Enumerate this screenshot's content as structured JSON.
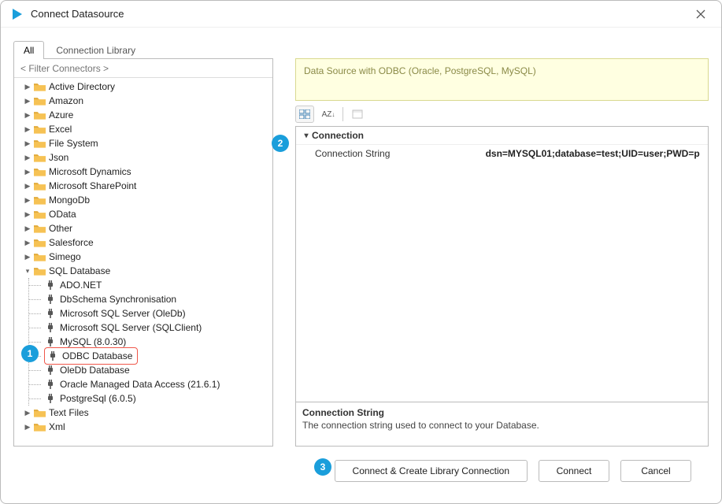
{
  "window": {
    "title": "Connect Datasource"
  },
  "tabs": {
    "all": "All",
    "lib": "Connection Library"
  },
  "filterPlaceholder": "< Filter Connectors >",
  "tree": {
    "activeDirectory": "Active Directory",
    "amazon": "Amazon",
    "azure": "Azure",
    "excel": "Excel",
    "fileSystem": "File System",
    "json": "Json",
    "msDynamics": "Microsoft Dynamics",
    "msSharepoint": "Microsoft SharePoint",
    "mongo": "MongoDb",
    "odata": "OData",
    "other": "Other",
    "salesforce": "Salesforce",
    "simego": "Simego",
    "sqlDb": "SQL Database",
    "sqlChildren": {
      "adonet": "ADO.NET",
      "dbschema": "DbSchema Synchronisation",
      "oledbSql": "Microsoft SQL Server (OleDb)",
      "sqlclient": "Microsoft SQL Server (SQLClient)",
      "mysql": "MySQL (8.0.30)",
      "odbc": "ODBC Database",
      "oledb": "OleDb Database",
      "oracle": "Oracle Managed Data Access (21.6.1)",
      "postgres": "PostgreSql (6.0.5)"
    },
    "textFiles": "Text Files",
    "xml": "Xml"
  },
  "right": {
    "banner": "Data Source with ODBC (Oracle, PostgreSQL, MySQL)",
    "category": "Connection",
    "propName": "Connection String",
    "propValue": "dsn=MYSQL01;database=test;UID=user;PWD=p",
    "descTitle": "Connection String",
    "descBody": "The connection string used to connect to your Database."
  },
  "buttons": {
    "createLib": "Connect & Create Library Connection",
    "connect": "Connect",
    "cancel": "Cancel"
  },
  "callouts": {
    "c1": "1",
    "c2": "2",
    "c3": "3"
  }
}
